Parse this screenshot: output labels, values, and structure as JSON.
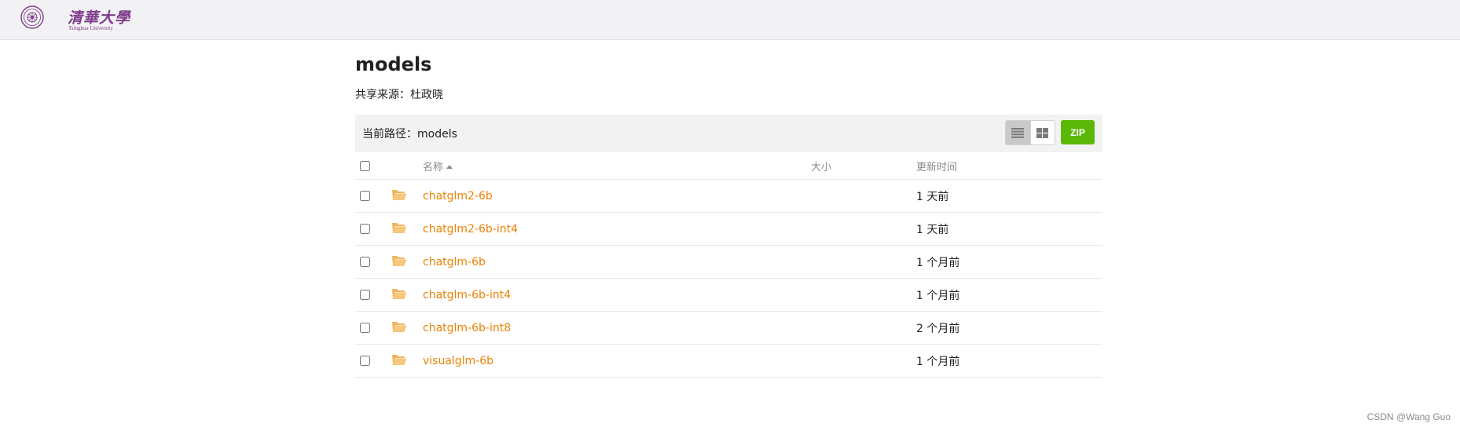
{
  "header": {
    "logo_cn": "清華大學",
    "logo_en": "Tsinghua University"
  },
  "page": {
    "title": "models",
    "share_source": "共享来源：杜政晓",
    "current_path": "当前路径：models",
    "zip_label": "ZIP"
  },
  "table": {
    "columns": {
      "name": "名称",
      "size": "大小",
      "time": "更新时间"
    },
    "rows": [
      {
        "name": "chatglm2-6b",
        "size": "",
        "time": "1 天前"
      },
      {
        "name": "chatglm2-6b-int4",
        "size": "",
        "time": "1 天前"
      },
      {
        "name": "chatglm-6b",
        "size": "",
        "time": "1 个月前"
      },
      {
        "name": "chatglm-6b-int4",
        "size": "",
        "time": "1 个月前"
      },
      {
        "name": "chatglm-6b-int8",
        "size": "",
        "time": "2 个月前"
      },
      {
        "name": "visualglm-6b",
        "size": "",
        "time": "1 个月前"
      }
    ]
  },
  "footer": {
    "credit": "CSDN @Wang Guo"
  },
  "colors": {
    "accent_link": "#eb8205",
    "zip_green": "#5cb808",
    "folder": "#f3b45e",
    "logo_purple": "#7d3a8c"
  }
}
